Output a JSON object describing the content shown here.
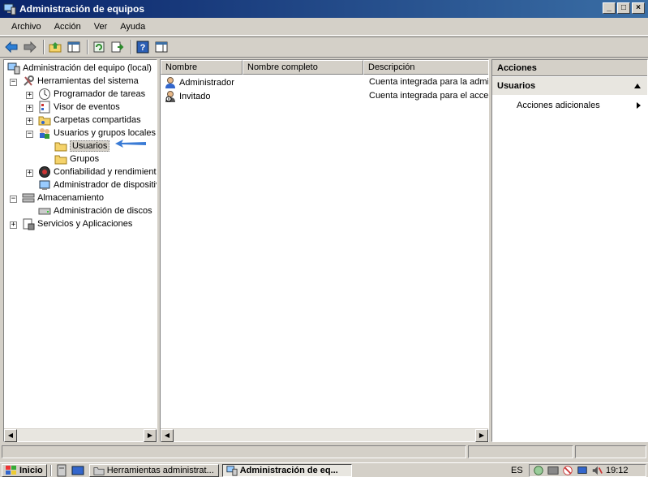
{
  "window": {
    "title": "Administración de equipos",
    "controls": {
      "minimize": "_",
      "maximize": "□",
      "close": "×"
    }
  },
  "menu": [
    "Archivo",
    "Acción",
    "Ver",
    "Ayuda"
  ],
  "toolbar_icons": [
    "back-arrow-icon",
    "forward-arrow-icon",
    "up-folder-icon",
    "show-hide-tree-icon",
    "refresh-icon",
    "export-list-icon",
    "help-icon",
    "show-hide-action-pane-icon"
  ],
  "tree": {
    "root": "Administración del equipo (local)",
    "system_tools": "Herramientas del sistema",
    "task_scheduler": "Programador de tareas",
    "event_viewer": "Visor de eventos",
    "shared_folders": "Carpetas compartidas",
    "local_users": "Usuarios y grupos locales",
    "users": "Usuarios",
    "groups": "Grupos",
    "reliability": "Confiabilidad y rendimiento",
    "device_manager": "Administrador de dispositivos",
    "storage": "Almacenamiento",
    "disk_management": "Administración de discos",
    "services": "Servicios y Aplicaciones",
    "expander_plus": "+",
    "expander_minus": "−"
  },
  "list": {
    "columns": [
      "Nombre",
      "Nombre completo",
      "Descripción"
    ],
    "rows": [
      {
        "name": "Administrador",
        "full_name": "",
        "description": "Cuenta integrada para la administración"
      },
      {
        "name": "Invitado",
        "full_name": "",
        "description": "Cuenta integrada para el acceso"
      }
    ]
  },
  "actions": {
    "header": "Acciones",
    "section": "Usuarios",
    "item": "Acciones adicionales"
  },
  "scroll_arrows": {
    "left": "◀",
    "right": "▶"
  },
  "taskbar": {
    "start": "Inicio",
    "tasks": [
      "Herramientas administrat...",
      "Administración de eq..."
    ],
    "lang": "ES",
    "clock": "19:12"
  },
  "colors": {
    "titlebar": "#0a246a",
    "accent_arrow": "#3a7bd5"
  }
}
